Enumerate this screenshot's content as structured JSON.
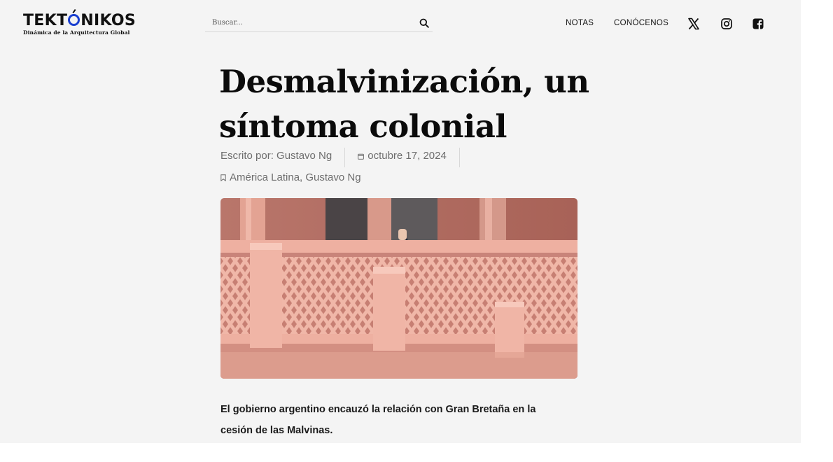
{
  "site": {
    "logo_text": "TEKTÓNIKOS",
    "logo_before_o": "TEKT",
    "logo_after_o": "NIKOS",
    "tagline": "Dinámica de la Arquitectura Global"
  },
  "search": {
    "placeholder": "Buscar...",
    "icon": "search-icon"
  },
  "nav": {
    "items": [
      {
        "label": "NOTAS"
      },
      {
        "label": "CONÓCENOS"
      }
    ],
    "social": [
      {
        "icon": "x-icon"
      },
      {
        "icon": "instagram-icon"
      },
      {
        "icon": "facebook-icon"
      }
    ]
  },
  "article": {
    "title_line1": "Desmalvinización, un",
    "title_line2": "síntoma colonial",
    "author": "Escrito por: Gustavo Ng",
    "date": "octubre 17, 2024",
    "categories": "América Latina, Gustavo Ng",
    "lead_line1": "El gobierno argentino encauzó la relación con Gran Bretaña en la",
    "lead_line2": "cesión de las Malvinas."
  },
  "colors": {
    "page_bg": "#f4f4f4",
    "logo_accent": "#1a3fd0",
    "meta_text": "#6d6d6d"
  }
}
